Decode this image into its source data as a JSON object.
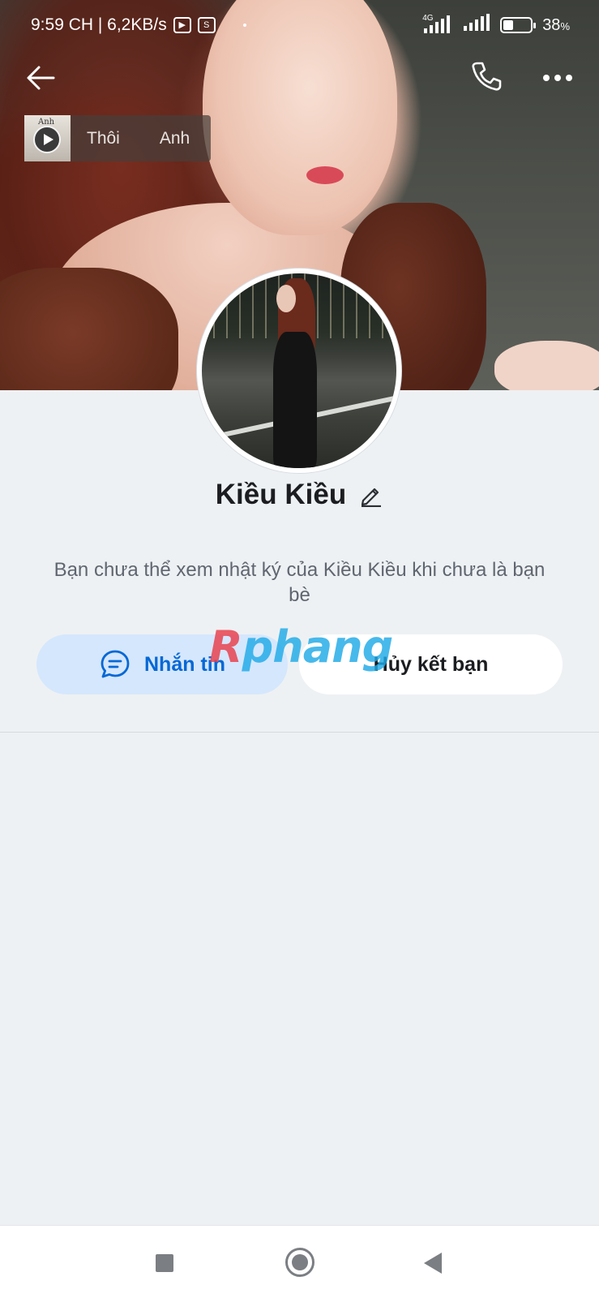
{
  "status_bar": {
    "time_speed": "9:59 CH | 6,2KB/s",
    "app_icon_1": "youtube-icon",
    "app_icon_2": "shopee-icon",
    "app_icon_2_glyph": "S",
    "network_type": "4G",
    "battery_level": 38,
    "battery_percent": "38",
    "battery_unit": "%"
  },
  "header": {
    "back_icon": "back-arrow-icon",
    "call_icon": "phone-icon",
    "more_icon": "more-dots-icon"
  },
  "music": {
    "thumb_label": "Anh",
    "title": "Thôi",
    "artist": "Anh"
  },
  "profile": {
    "name": "Kiều Kiều",
    "edit_icon": "pencil-icon",
    "info_text": "Bạn chưa thể xem nhật ký của Kiều Kiều khi chưa là bạn bè"
  },
  "actions": {
    "message_label": "Nhắn tin",
    "message_icon": "chat-bubble-icon",
    "unfriend_label": "Hủy kết bạn"
  },
  "watermark": {
    "first": "R",
    "rest": "phang"
  },
  "colors": {
    "accent": "#0568d5",
    "message_bg": "#d5e7fd",
    "page_bg": "#eef1f3"
  }
}
